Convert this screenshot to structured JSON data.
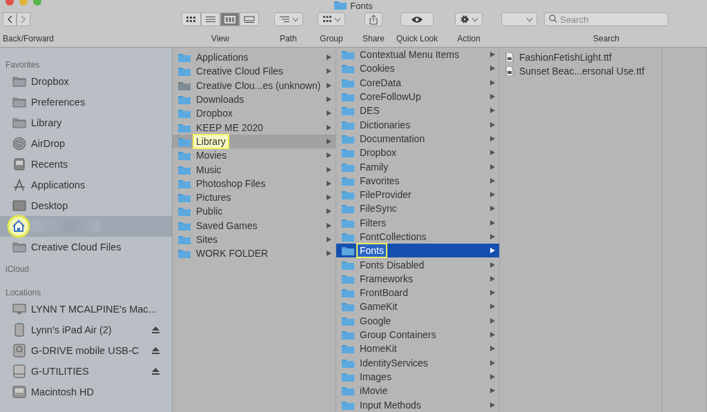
{
  "window": {
    "title": "Fonts"
  },
  "toolbar": [
    {
      "kind": "nav",
      "label": "Back/Forward"
    },
    {
      "kind": "view",
      "label": "View",
      "modes": [
        {
          "kind": "icons",
          "selected": false
        },
        {
          "kind": "list",
          "selected": false
        },
        {
          "kind": "columns",
          "selected": true
        },
        {
          "kind": "gallery",
          "selected": false
        }
      ]
    },
    {
      "kind": "path",
      "label": "Path"
    },
    {
      "kind": "group",
      "label": "Group"
    },
    {
      "kind": "share",
      "label": "Share"
    },
    {
      "kind": "quicklook",
      "label": "Quick Look"
    },
    {
      "kind": "action",
      "label": "Action"
    },
    {
      "kind": "dropdown"
    },
    {
      "kind": "search",
      "label": "Search",
      "placeholder": "Search"
    }
  ],
  "sidebar": {
    "sections": [
      {
        "title": "Favorites",
        "items": [
          {
            "kind": "folder",
            "label": "Dropbox",
            "selected": false
          },
          {
            "kind": "folder",
            "label": "Preferences",
            "selected": false
          },
          {
            "kind": "folder",
            "label": "Library",
            "selected": false
          },
          {
            "kind": "airdrop",
            "label": "AirDrop",
            "selected": false
          },
          {
            "kind": "recents",
            "label": "Recents",
            "selected": false
          },
          {
            "kind": "applications",
            "label": "Applications",
            "selected": false
          },
          {
            "kind": "desktop",
            "label": "Desktop",
            "selected": false
          },
          {
            "kind": "home",
            "selected": true,
            "highlighted": true
          },
          {
            "kind": "folder",
            "label": "Creative Cloud Files",
            "selected": false
          }
        ]
      },
      {
        "title": "iCloud"
      },
      {
        "title": "Locations",
        "items": [
          {
            "kind": "computer",
            "label": "LYNN T MCALPINE's Mac...",
            "selected": false,
            "eject": false
          },
          {
            "kind": "ipad",
            "label": "Lynn's iPad Air (2)",
            "selected": false,
            "eject": true
          },
          {
            "kind": "timemachine",
            "label": "G-DRIVE mobile USB-C",
            "selected": false,
            "eject": true
          },
          {
            "kind": "drive",
            "label": "G-UTILITIES",
            "selected": false,
            "eject": true
          },
          {
            "kind": "disk",
            "label": "Macintosh HD",
            "selected": false,
            "eject": false
          }
        ]
      }
    ]
  },
  "columns": [
    {
      "focused": false,
      "items": [
        {
          "kind": "folder",
          "name": "Applications",
          "selected": false,
          "highlighted": false
        },
        {
          "kind": "folder",
          "name": "Creative Cloud Files",
          "selected": false,
          "highlighted": false
        },
        {
          "kind": "unknown",
          "name": "Creative Clou...es (unknown)",
          "selected": false,
          "highlighted": false
        },
        {
          "kind": "folder",
          "name": "Downloads",
          "selected": false,
          "highlighted": false
        },
        {
          "kind": "folder",
          "name": "Dropbox",
          "selected": false,
          "highlighted": false
        },
        {
          "kind": "folder",
          "name": "KEEP ME 2020",
          "selected": false,
          "highlighted": false
        },
        {
          "kind": "folder",
          "name": "Library",
          "selected": true,
          "highlighted": true
        },
        {
          "kind": "folder",
          "name": "Movies",
          "selected": false,
          "highlighted": false
        },
        {
          "kind": "folder",
          "name": "Music",
          "selected": false,
          "highlighted": false
        },
        {
          "kind": "folder",
          "name": "Photoshop Files",
          "selected": false,
          "highlighted": false
        },
        {
          "kind": "folder",
          "name": "Pictures",
          "selected": false,
          "highlighted": false
        },
        {
          "kind": "folder",
          "name": "Public",
          "selected": false,
          "highlighted": false
        },
        {
          "kind": "folder",
          "name": "Saved Games",
          "selected": false,
          "highlighted": false
        },
        {
          "kind": "folder",
          "name": "Sites",
          "selected": false,
          "highlighted": false
        },
        {
          "kind": "folder",
          "name": "WORK FOLDER",
          "selected": false,
          "highlighted": false
        }
      ]
    },
    {
      "focused": true,
      "items": [
        {
          "kind": "folder",
          "name": "Contextual Menu Items",
          "selected": false,
          "highlighted": false
        },
        {
          "kind": "folder",
          "name": "Cookies",
          "selected": false,
          "highlighted": false
        },
        {
          "kind": "folder",
          "name": "CoreData",
          "selected": false,
          "highlighted": false
        },
        {
          "kind": "folder",
          "name": "CoreFollowUp",
          "selected": false,
          "highlighted": false
        },
        {
          "kind": "folder",
          "name": "DES",
          "selected": false,
          "highlighted": false
        },
        {
          "kind": "folder",
          "name": "Dictionaries",
          "selected": false,
          "highlighted": false
        },
        {
          "kind": "folder",
          "name": "Documentation",
          "selected": false,
          "highlighted": false
        },
        {
          "kind": "folder",
          "name": "Dropbox",
          "selected": false,
          "highlighted": false
        },
        {
          "kind": "folder",
          "name": "Family",
          "selected": false,
          "highlighted": false
        },
        {
          "kind": "folder",
          "name": "Favorites",
          "selected": false,
          "highlighted": false
        },
        {
          "kind": "folder",
          "name": "FileProvider",
          "selected": false,
          "highlighted": false
        },
        {
          "kind": "folder",
          "name": "FileSync",
          "selected": false,
          "highlighted": false
        },
        {
          "kind": "folder",
          "name": "Filters",
          "selected": false,
          "highlighted": false
        },
        {
          "kind": "folder",
          "name": "FontCollections",
          "selected": false,
          "highlighted": false
        },
        {
          "kind": "folder",
          "name": "Fonts",
          "selected": true,
          "highlighted": true
        },
        {
          "kind": "folder",
          "name": "Fonts Disabled",
          "selected": false,
          "highlighted": false
        },
        {
          "kind": "folder",
          "name": "Frameworks",
          "selected": false,
          "highlighted": false
        },
        {
          "kind": "folder",
          "name": "FrontBoard",
          "selected": false,
          "highlighted": false
        },
        {
          "kind": "folder",
          "name": "GameKit",
          "selected": false,
          "highlighted": false
        },
        {
          "kind": "folder",
          "name": "Google",
          "selected": false,
          "highlighted": false
        },
        {
          "kind": "folder",
          "name": "Group Containers",
          "selected": false,
          "highlighted": false
        },
        {
          "kind": "folder",
          "name": "HomeKit",
          "selected": false,
          "highlighted": false
        },
        {
          "kind": "folder",
          "name": "IdentityServices",
          "selected": false,
          "highlighted": false
        },
        {
          "kind": "folder",
          "name": "Images",
          "selected": false,
          "highlighted": false
        },
        {
          "kind": "folder",
          "name": "iMovie",
          "selected": false,
          "highlighted": false
        },
        {
          "kind": "folder",
          "name": "Input Methods",
          "selected": false,
          "highlighted": false
        }
      ]
    },
    {
      "items": [
        {
          "kind": "file",
          "name": "FashionFetishLight.ttf",
          "selected": false,
          "highlighted": false
        },
        {
          "kind": "file",
          "name": "Sunset Beac...ersonal Use.ttf",
          "selected": false,
          "highlighted": false
        }
      ]
    },
    {}
  ]
}
